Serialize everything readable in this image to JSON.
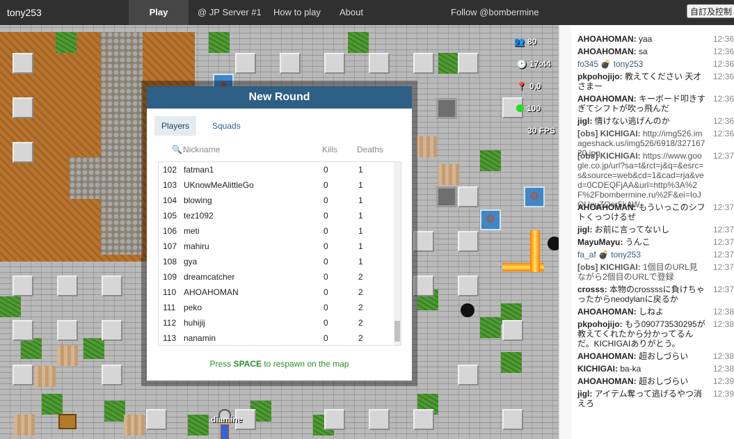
{
  "topbar": {
    "user": "tony253",
    "play": "Play",
    "server": "@ JP Server #1",
    "how_to_play": "How to play",
    "about": "About",
    "follow": "Follow @bombermine",
    "extension_button": "自訂及控制"
  },
  "hud": {
    "players": "80",
    "timer": "17:44",
    "coords": "0,0",
    "health": "100",
    "fps": "30 FPS",
    "player_name": "diamine"
  },
  "dialog": {
    "title": "New Round",
    "tabs": [
      "Players",
      "Squads"
    ],
    "columns": {
      "search_placeholder": "Nickname",
      "kills": "Kills",
      "deaths": "Deaths"
    },
    "rows": [
      {
        "rank": "102",
        "name": "fatman1",
        "kills": "0",
        "deaths": "1"
      },
      {
        "rank": "103",
        "name": "UKnowMeAlittleGo",
        "kills": "0",
        "deaths": "1"
      },
      {
        "rank": "104",
        "name": "blowing",
        "kills": "0",
        "deaths": "1"
      },
      {
        "rank": "105",
        "name": "tez1092",
        "kills": "0",
        "deaths": "1"
      },
      {
        "rank": "106",
        "name": "meti",
        "kills": "0",
        "deaths": "1"
      },
      {
        "rank": "107",
        "name": "mahiru",
        "kills": "0",
        "deaths": "1"
      },
      {
        "rank": "108",
        "name": "gya",
        "kills": "0",
        "deaths": "1"
      },
      {
        "rank": "109",
        "name": "dreamcatcher",
        "kills": "0",
        "deaths": "2"
      },
      {
        "rank": "110",
        "name": "AHOAHOMAN",
        "kills": "0",
        "deaths": "2"
      },
      {
        "rank": "111",
        "name": "peko",
        "kills": "0",
        "deaths": "2"
      },
      {
        "rank": "112",
        "name": "huhijij",
        "kills": "0",
        "deaths": "2"
      },
      {
        "rank": "113",
        "name": "nanamin",
        "kills": "0",
        "deaths": "2"
      }
    ],
    "respawn_pre": "Press ",
    "respawn_key": "SPACE",
    "respawn_post": " to respawn on the map"
  },
  "chat": [
    {
      "sender": "AHOAHOMAN:",
      "text": " yaa",
      "time": "12:36"
    },
    {
      "sender": "AHOAHOMAN:",
      "text": " sa",
      "time": "12:36"
    },
    {
      "sender": "",
      "text": "fo345 💣 tony253",
      "time": "12:36",
      "kind": "sys"
    },
    {
      "sender": "pkpohojijo:",
      "text": " 教えてください 天才さまー",
      "time": "12:36"
    },
    {
      "sender": "AHOAHOMAN:",
      "text": " キーボード叩きすぎてシフトが吹っ飛んだ",
      "time": "12:36"
    },
    {
      "sender": "jigl:",
      "text": " 情けない逃げんのか",
      "time": "12:36"
    },
    {
      "sender": "[obs] KICHIGAI:",
      "text": " http://img526.imageshack.us/img526/6918/32716720.jpg",
      "time": "12:36",
      "kind": "obs"
    },
    {
      "sender": "[obs] KICHIGAI:",
      "text": " https://www.google.co.jp/url?sa=t&rct=j&q=&esrc=s&source=web&cd=1&cad=rja&ved=0CDEQFjAA&url=http%3A%2F%2Fbombermine.ru%2F&ei=IoJOUeyZOor5kAW",
      "time": "12:37",
      "kind": "obs"
    },
    {
      "sender": "AHOAHOMAN:",
      "text": " もういっこのシフトくっつけるぜ",
      "time": "12:37"
    },
    {
      "sender": "jigl:",
      "text": " お前に言ってないし",
      "time": "12:37"
    },
    {
      "sender": "MayuMayu:",
      "text": " うんこ",
      "time": "12:37"
    },
    {
      "sender": "",
      "text": "fa_af 💣 tony253",
      "time": "12:37",
      "kind": "sys"
    },
    {
      "sender": "[obs] KICHIGAI:",
      "text": " 1個目のURL見ながら2個目のURLで登録",
      "time": "12:37",
      "kind": "obs"
    },
    {
      "sender": "crosss:",
      "text": " 本物のcrossssに負けちゃったからneodylanに戻るか",
      "time": "12:37"
    },
    {
      "sender": "AHOAHOMAN:",
      "text": " しねよ",
      "time": "12:38"
    },
    {
      "sender": "pkpohojijo:",
      "text": " もう090773530295が教えてくれたから分かってるんだ。KICHIGAIありがとう。",
      "time": "12:38"
    },
    {
      "sender": "AHOAHOMAN:",
      "text": " 超おしづらい",
      "time": "12:38"
    },
    {
      "sender": "KICHIGAI:",
      "text": " ba-ka",
      "time": "12:38"
    },
    {
      "sender": "AHOAHOMAN:",
      "text": " 超おしづらい",
      "time": "12:39"
    },
    {
      "sender": "jigl:",
      "text": " アイテム奪って逃げるやつ消えろ",
      "time": "12:39"
    }
  ],
  "colors": {
    "accent": "#2e5f84",
    "topbar": "#303030",
    "respawn": "#2a8f2a"
  }
}
